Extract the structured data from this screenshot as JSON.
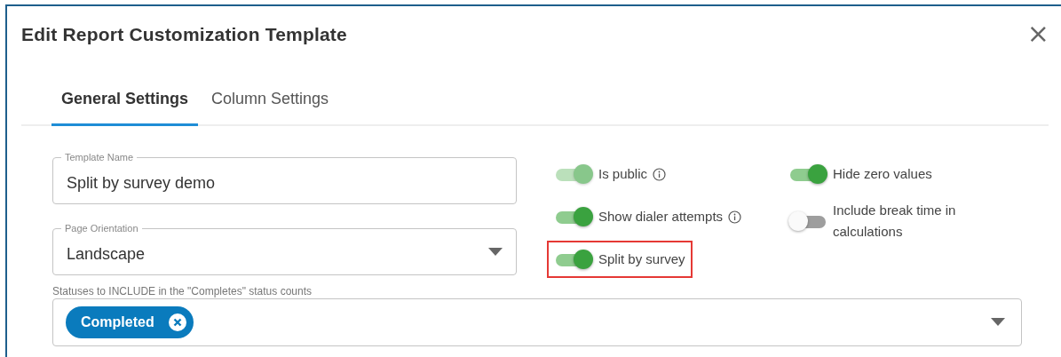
{
  "dialog": {
    "title": "Edit Report Customization Template",
    "close": "×"
  },
  "tabs": [
    {
      "label": "General Settings",
      "selected": true
    },
    {
      "label": "Column Settings",
      "selected": false
    }
  ],
  "fields": [
    {
      "kind": "text",
      "label": "Template Name",
      "value": "Split by survey demo"
    },
    {
      "kind": "select",
      "label": "Page Orientation",
      "value": "Landscape"
    }
  ],
  "toggles_left": [
    {
      "label": "Is public",
      "on": true,
      "disabled": true,
      "info": true,
      "highlighted": false
    },
    {
      "label": "Show dialer attempts",
      "on": true,
      "disabled": false,
      "info": true,
      "highlighted": false
    },
    {
      "label": "Split by survey",
      "on": true,
      "disabled": false,
      "info": false,
      "highlighted": true
    }
  ],
  "toggles_right": [
    {
      "label": "Hide zero values",
      "on": true,
      "disabled": false,
      "info": false,
      "highlighted": false
    },
    {
      "label": "Include break time in calculations",
      "on": false,
      "disabled": false,
      "info": false,
      "highlighted": false
    }
  ],
  "statuses": {
    "label": "Statuses to INCLUDE in the \"Completes\" status counts",
    "chips": [
      "Completed"
    ]
  }
}
